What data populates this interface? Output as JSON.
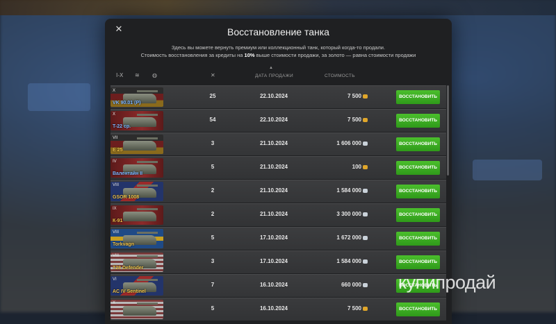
{
  "modal": {
    "title": "Восстановление танка",
    "desc_line1": "Здесь вы можете вернуть премиум или коллекционный танк, который когда-то продали.",
    "desc_line2_a": "Стоимость восстановления за кредиты на ",
    "desc_line2_b": "10%",
    "desc_line2_c": " выше стоимости продажи, за золото — равна стоимости продажи"
  },
  "header": {
    "tier_filter": "I-X",
    "col_date": "ДАТА ПРОДАЖИ",
    "col_cost": "СТОИМОСТЬ",
    "sort_indicator": "▲"
  },
  "rows": [
    {
      "tier": "X",
      "name": "VK 90.01 (P)",
      "flag": "de",
      "name_color": "#7fb6ff",
      "battles": "25",
      "date": "22.10.2024",
      "cost": "7 500",
      "currency": "gold",
      "button": "ВОССТАНОВИТЬ"
    },
    {
      "tier": "X",
      "name": "T-22 ср.",
      "flag": "ussr",
      "name_color": "#7fb6ff",
      "battles": "54",
      "date": "22.10.2024",
      "cost": "7 500",
      "currency": "gold",
      "button": "ВОССТАНОВИТЬ"
    },
    {
      "tier": "VII",
      "name": "E 25",
      "flag": "de",
      "name_color": "#f0c24a",
      "battles": "3",
      "date": "21.10.2024",
      "cost": "1 606 000",
      "currency": "silver",
      "button": "ВОССТАНОВИТЬ"
    },
    {
      "tier": "IV",
      "name": "Валентайн II",
      "flag": "ussr",
      "name_color": "#7fb6ff",
      "battles": "5",
      "date": "21.10.2024",
      "cost": "100",
      "currency": "gold",
      "button": "ВОССТАНОВИТЬ"
    },
    {
      "tier": "VIII",
      "name": "GSOR 1008",
      "flag": "uk",
      "name_color": "#f0c24a",
      "battles": "2",
      "date": "21.10.2024",
      "cost": "1 584 000",
      "currency": "silver",
      "button": "ВОССТАНОВИТЬ"
    },
    {
      "tier": "IX",
      "name": "К-91",
      "flag": "ussr",
      "name_color": "#f0c24a",
      "battles": "2",
      "date": "21.10.2024",
      "cost": "3 300 000",
      "currency": "silver",
      "button": "ВОССТАНОВИТЬ"
    },
    {
      "tier": "VIII",
      "name": "Torkvagn",
      "flag": "se",
      "name_color": "#f0c24a",
      "battles": "5",
      "date": "17.10.2024",
      "cost": "1 672 000",
      "currency": "silver",
      "button": "ВОССТАНОВИТЬ"
    },
    {
      "tier": "VIII",
      "name": "T28 Defender",
      "flag": "usa",
      "name_color": "#f0c24a",
      "battles": "3",
      "date": "17.10.2024",
      "cost": "1 584 000",
      "currency": "silver",
      "button": "ВОССТАНОВИТЬ"
    },
    {
      "tier": "VI",
      "name": "AC IV Sentinel",
      "flag": "uk",
      "name_color": "#f0c24a",
      "battles": "7",
      "date": "16.10.2024",
      "cost": "660 000",
      "currency": "silver",
      "button": "ВОССТАНОВИТЬ"
    },
    {
      "tier": "X",
      "name": "",
      "flag": "usa",
      "name_color": "#7fb6ff",
      "battles": "5",
      "date": "16.10.2024",
      "cost": "7 500",
      "currency": "gold",
      "button": "ВОССТАНОВИТЬ"
    }
  ],
  "watermark": "купипродай",
  "icons": {
    "close": "close-icon",
    "tier": "tier-filter-icon",
    "type": "tank-type-icon",
    "nation": "nation-globe-icon",
    "battles": "crossed-swords-icon",
    "gold": "gold-coin-icon",
    "silver": "credits-icon"
  },
  "colors": {
    "accent_green": "#3aac22",
    "gold": "#e0a62a",
    "credits": "#c9d1d9"
  }
}
